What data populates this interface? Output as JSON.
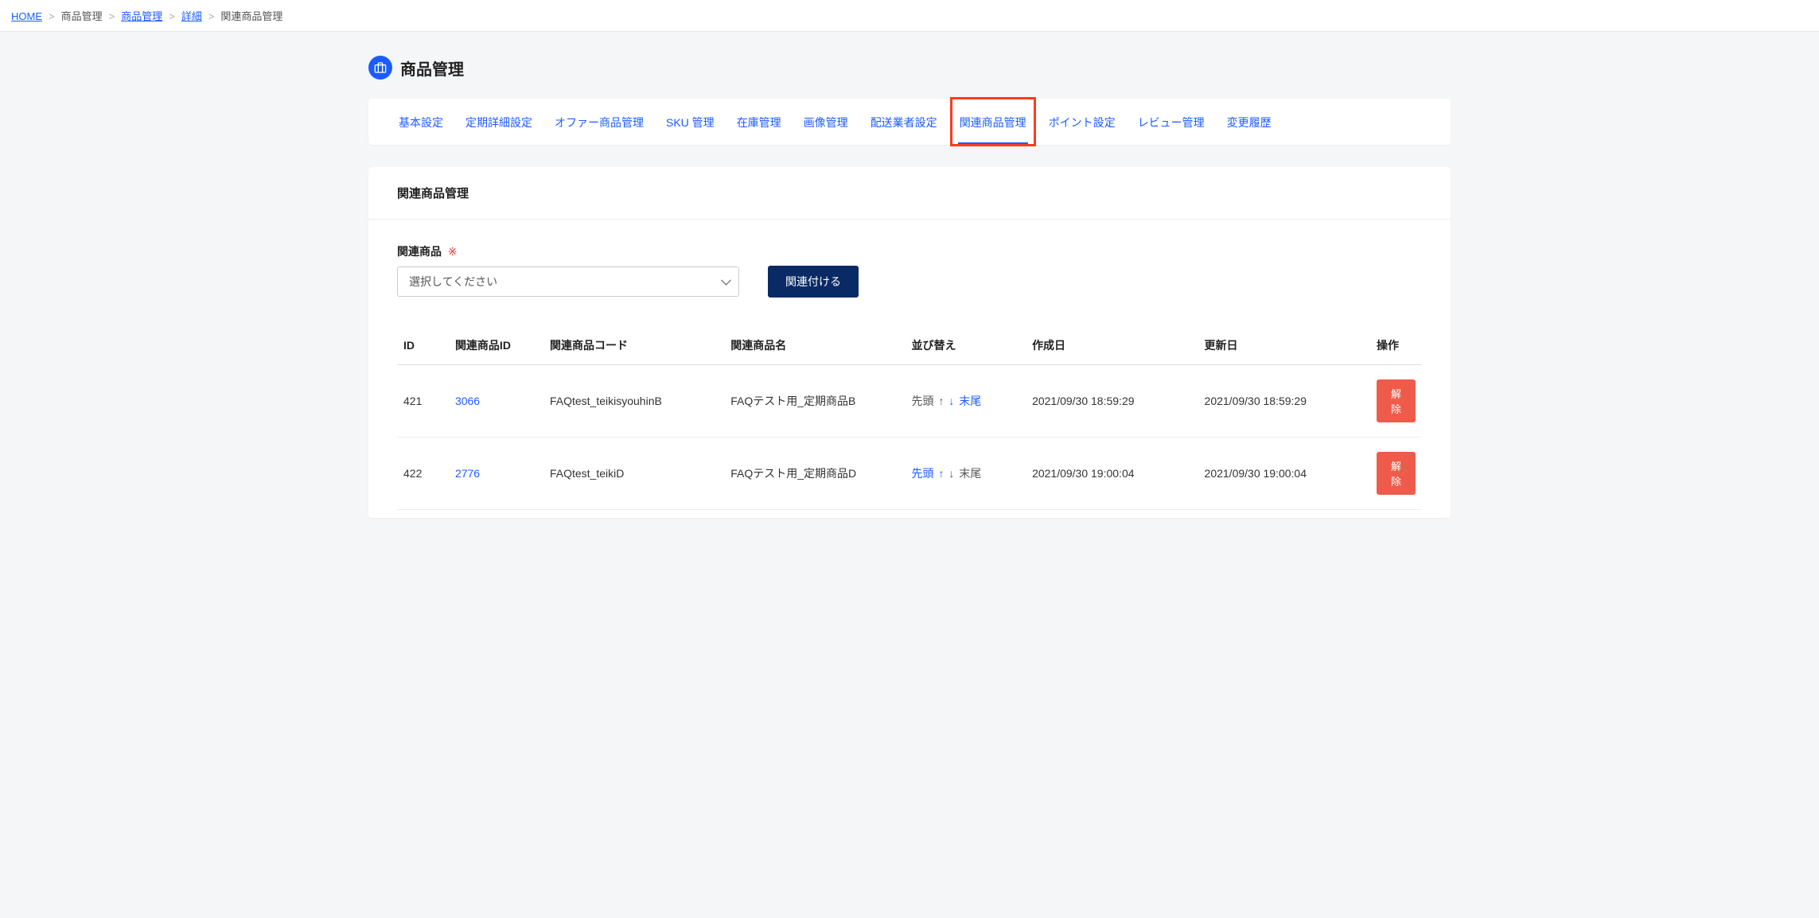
{
  "breadcrumb": [
    {
      "label": "HOME",
      "link": true
    },
    {
      "label": "商品管理",
      "link": false
    },
    {
      "label": "商品管理",
      "link": true
    },
    {
      "label": "詳細",
      "link": true
    },
    {
      "label": "関連商品管理",
      "link": false
    }
  ],
  "page": {
    "title": "商品管理",
    "icon": "briefcase-icon"
  },
  "tabs": [
    {
      "label": "基本設定",
      "active": false
    },
    {
      "label": "定期詳細設定",
      "active": false
    },
    {
      "label": "オファー商品管理",
      "active": false
    },
    {
      "label": "SKU 管理",
      "active": false
    },
    {
      "label": "在庫管理",
      "active": false
    },
    {
      "label": "画像管理",
      "active": false
    },
    {
      "label": "配送業者設定",
      "active": false
    },
    {
      "label": "関連商品管理",
      "active": true
    },
    {
      "label": "ポイント設定",
      "active": false
    },
    {
      "label": "レビュー管理",
      "active": false
    },
    {
      "label": "変更履歴",
      "active": false
    }
  ],
  "section": {
    "title": "関連商品管理",
    "field_label": "関連商品",
    "required_mark": "※",
    "select_placeholder": "選択してください",
    "associate_button": "関連付ける"
  },
  "table": {
    "headers": {
      "id": "ID",
      "related_id": "関連商品ID",
      "related_code": "関連商品コード",
      "related_name": "関連商品名",
      "sort": "並び替え",
      "created": "作成日",
      "updated": "更新日",
      "op": "操作"
    },
    "sort_labels": {
      "first": "先頭",
      "up": "↑",
      "down": "↓",
      "last": "末尾"
    },
    "delete_label": "解除",
    "rows": [
      {
        "id": "421",
        "related_id": "3066",
        "related_code": "FAQtest_teikisyouhinB",
        "related_name": "FAQテスト用_定期商品B",
        "sort_state": {
          "first": false,
          "up": false,
          "down": true,
          "last": true
        },
        "created": "2021/09/30 18:59:29",
        "updated": "2021/09/30 18:59:29"
      },
      {
        "id": "422",
        "related_id": "2776",
        "related_code": "FAQtest_teikiD",
        "related_name": "FAQテスト用_定期商品D",
        "sort_state": {
          "first": true,
          "up": true,
          "down": false,
          "last": false
        },
        "created": "2021/09/30 19:00:04",
        "updated": "2021/09/30 19:00:04"
      }
    ]
  }
}
